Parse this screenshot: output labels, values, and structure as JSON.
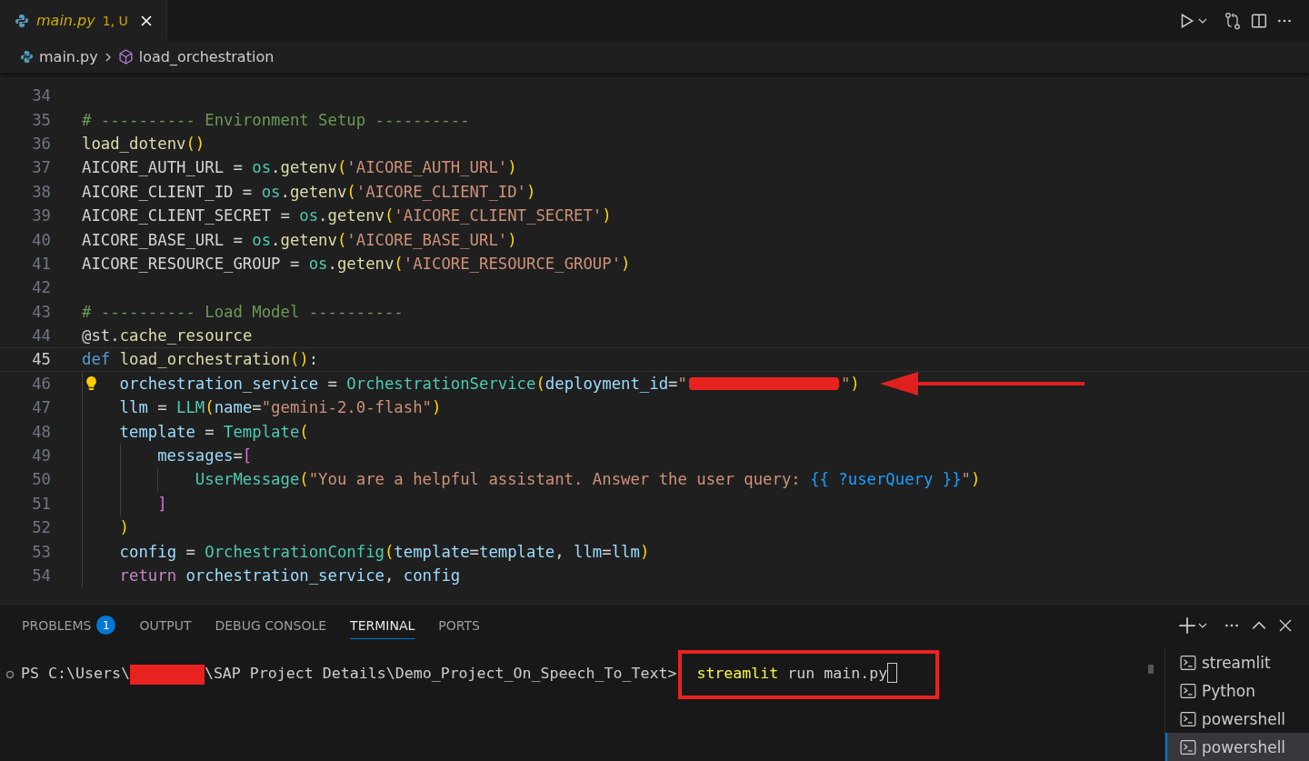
{
  "editor_tab": {
    "filename": "main.py",
    "status": "1, U"
  },
  "breadcrumb": {
    "file": "main.py",
    "symbol": "load_orchestration"
  },
  "code_lines": [
    {
      "number": "34",
      "current": false
    },
    {
      "number": "35",
      "current": false,
      "tokens": [
        {
          "kind": "comment",
          "text": "# ---------- Environment Setup ----------"
        }
      ]
    },
    {
      "number": "36",
      "current": false,
      "tokens": [
        {
          "kind": "function",
          "text": "load_dotenv"
        },
        {
          "kind": "paren",
          "text": "()"
        }
      ]
    },
    {
      "number": "37",
      "current": false,
      "tokens": [
        {
          "kind": "plain",
          "text": "AICORE_AUTH_URL = "
        },
        {
          "kind": "module",
          "text": "os"
        },
        {
          "kind": "plain",
          "text": "."
        },
        {
          "kind": "function",
          "text": "getenv"
        },
        {
          "kind": "paren",
          "text": "("
        },
        {
          "kind": "string",
          "text": "'AICORE_AUTH_URL'"
        },
        {
          "kind": "paren",
          "text": ")"
        }
      ]
    },
    {
      "number": "38",
      "current": false,
      "tokens": [
        {
          "kind": "plain",
          "text": "AICORE_CLIENT_ID = "
        },
        {
          "kind": "module",
          "text": "os"
        },
        {
          "kind": "plain",
          "text": "."
        },
        {
          "kind": "function",
          "text": "getenv"
        },
        {
          "kind": "paren",
          "text": "("
        },
        {
          "kind": "string",
          "text": "'AICORE_CLIENT_ID'"
        },
        {
          "kind": "paren",
          "text": ")"
        }
      ]
    },
    {
      "number": "39",
      "current": false,
      "tokens": [
        {
          "kind": "plain",
          "text": "AICORE_CLIENT_SECRET = "
        },
        {
          "kind": "module",
          "text": "os"
        },
        {
          "kind": "plain",
          "text": "."
        },
        {
          "kind": "function",
          "text": "getenv"
        },
        {
          "kind": "paren",
          "text": "("
        },
        {
          "kind": "string",
          "text": "'AICORE_CLIENT_SECRET'"
        },
        {
          "kind": "paren",
          "text": ")"
        }
      ]
    },
    {
      "number": "40",
      "current": false,
      "tokens": [
        {
          "kind": "plain",
          "text": "AICORE_BASE_URL = "
        },
        {
          "kind": "module",
          "text": "os"
        },
        {
          "kind": "plain",
          "text": "."
        },
        {
          "kind": "function",
          "text": "getenv"
        },
        {
          "kind": "paren",
          "text": "("
        },
        {
          "kind": "string",
          "text": "'AICORE_BASE_URL'"
        },
        {
          "kind": "paren",
          "text": ")"
        }
      ]
    },
    {
      "number": "41",
      "current": false,
      "tokens": [
        {
          "kind": "plain",
          "text": "AICORE_RESOURCE_GROUP = "
        },
        {
          "kind": "module",
          "text": "os"
        },
        {
          "kind": "plain",
          "text": "."
        },
        {
          "kind": "function",
          "text": "getenv"
        },
        {
          "kind": "paren",
          "text": "("
        },
        {
          "kind": "string",
          "text": "'AICORE_RESOURCE_GROUP'"
        },
        {
          "kind": "paren",
          "text": ")"
        }
      ]
    },
    {
      "number": "42",
      "current": false
    },
    {
      "number": "43",
      "current": false,
      "tokens": [
        {
          "kind": "comment",
          "text": "# ---------- Load Model ----------"
        }
      ]
    },
    {
      "number": "44",
      "current": false,
      "tokens": [
        {
          "kind": "plain",
          "text": "@st."
        },
        {
          "kind": "function",
          "text": "cache_resource"
        }
      ]
    },
    {
      "number": "45",
      "current": true,
      "tokens": [
        {
          "kind": "keyword",
          "text": "def "
        },
        {
          "kind": "function",
          "text": "load_orchestration"
        },
        {
          "kind": "paren",
          "text": "()"
        },
        {
          "kind": "plain",
          "text": ":"
        }
      ],
      "children": [
        {
          "number": "46",
          "current": false,
          "lightbulb": true,
          "arrow": true,
          "tokens": [
            {
              "kind": "variable",
              "text": "orchestration_service"
            },
            {
              "kind": "plain",
              "text": " = "
            },
            {
              "kind": "class",
              "text": "OrchestrationService"
            },
            {
              "kind": "paren",
              "text": "("
            },
            {
              "kind": "variable",
              "text": "deployment_id"
            },
            {
              "kind": "plain",
              "text": "="
            },
            {
              "kind": "string",
              "text": "\""
            },
            {
              "kind": "redacted"
            },
            {
              "kind": "string",
              "text": "\""
            },
            {
              "kind": "paren",
              "text": ")"
            }
          ]
        },
        {
          "number": "47",
          "current": false,
          "tokens": [
            {
              "kind": "variable",
              "text": "llm"
            },
            {
              "kind": "plain",
              "text": " = "
            },
            {
              "kind": "class",
              "text": "LLM"
            },
            {
              "kind": "paren",
              "text": "("
            },
            {
              "kind": "variable",
              "text": "name"
            },
            {
              "kind": "plain",
              "text": "="
            },
            {
              "kind": "string",
              "text": "\"gemini-2.0-flash\""
            },
            {
              "kind": "paren",
              "text": ")"
            }
          ]
        },
        {
          "number": "48",
          "current": false,
          "tokens": [
            {
              "kind": "variable",
              "text": "template"
            },
            {
              "kind": "plain",
              "text": " = "
            },
            {
              "kind": "class",
              "text": "Template"
            },
            {
              "kind": "paren",
              "text": "("
            }
          ],
          "children": [
            {
              "number": "49",
              "current": false,
              "tokens": [
                {
                  "kind": "variable",
                  "text": "messages"
                },
                {
                  "kind": "plain",
                  "text": "="
                },
                {
                  "kind": "bracket",
                  "text": "["
                }
              ],
              "children": [
                {
                  "number": "50",
                  "current": false,
                  "tokens": [
                    {
                      "kind": "class",
                      "text": "UserMessage"
                    },
                    {
                      "kind": "paren",
                      "text": "("
                    },
                    {
                      "kind": "string",
                      "text": "\"You are a helpful assistant. Answer the user query: "
                    },
                    {
                      "kind": "brace",
                      "text": "{{ ?userQuery }}"
                    },
                    {
                      "kind": "string",
                      "text": "\""
                    },
                    {
                      "kind": "paren",
                      "text": ")"
                    }
                  ]
                }
              ]
            },
            {
              "number": "51",
              "current": false,
              "tokens": [
                {
                  "kind": "bracket",
                  "text": "]"
                }
              ]
            }
          ]
        },
        {
          "number": "52",
          "current": false,
          "tokens": [
            {
              "kind": "paren",
              "text": ")"
            }
          ]
        },
        {
          "number": "53",
          "current": false,
          "tokens": [
            {
              "kind": "variable",
              "text": "config"
            },
            {
              "kind": "plain",
              "text": " = "
            },
            {
              "kind": "class",
              "text": "OrchestrationConfig"
            },
            {
              "kind": "paren",
              "text": "("
            },
            {
              "kind": "variable",
              "text": "template"
            },
            {
              "kind": "plain",
              "text": "="
            },
            {
              "kind": "variable",
              "text": "template"
            },
            {
              "kind": "plain",
              "text": ", "
            },
            {
              "kind": "variable",
              "text": "llm"
            },
            {
              "kind": "plain",
              "text": "="
            },
            {
              "kind": "variable",
              "text": "llm"
            },
            {
              "kind": "paren",
              "text": ")"
            }
          ]
        },
        {
          "number": "54",
          "current": false,
          "tokens": [
            {
              "kind": "keyword2",
              "text": "return "
            },
            {
              "kind": "variable",
              "text": "orchestration_service"
            },
            {
              "kind": "plain",
              "text": ", "
            },
            {
              "kind": "variable",
              "text": "config"
            }
          ]
        }
      ]
    }
  ],
  "panel_tabs": [
    {
      "label": "PROBLEMS",
      "badge": "1",
      "selected": false
    },
    {
      "label": "OUTPUT",
      "selected": false
    },
    {
      "label": "DEBUG CONSOLE",
      "selected": false
    },
    {
      "label": "TERMINAL",
      "selected": true
    },
    {
      "label": "PORTS",
      "selected": false
    }
  ],
  "terminal": {
    "prompt_start": "PS C:\\Users\\",
    "prompt_end": "\\SAP Project Details\\Demo_Project_On_Speech_To_Text>",
    "command": "streamlit",
    "args": " run main.py"
  },
  "terminal_list": [
    {
      "label": "streamlit",
      "selected": false
    },
    {
      "label": "Python",
      "selected": false
    },
    {
      "label": "powershell",
      "selected": false
    },
    {
      "label": "powershell",
      "selected": true
    }
  ]
}
